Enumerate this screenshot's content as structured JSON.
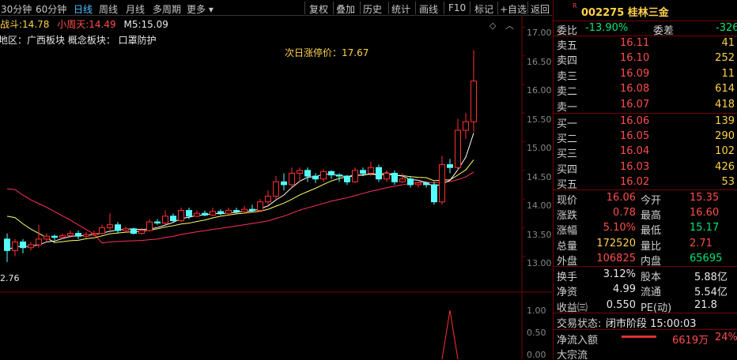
{
  "toolbar": {
    "periods": [
      "30分钟",
      "60分钟",
      "日线",
      "周线",
      "月线",
      "多周期",
      "更多"
    ],
    "more_arrow": "▾",
    "tools": [
      "复权",
      "叠加",
      "历史",
      "统计",
      "画线",
      "F10",
      "标记",
      "+自选",
      "返回"
    ]
  },
  "chart": {
    "indicator_name": "战斗:",
    "indicator_value": "14.78",
    "small_weekday_name": "小周天:",
    "small_weekday_value": "14.49",
    "ma5_label": "M5:",
    "ma5_value": "15.09",
    "region_line": "所属地区：广西板块   概念板块：   口罩防护",
    "limit_up_label": "次日涨停价：17.67",
    "low_value": "2.76",
    "yaxis_ticks": [
      "17.00",
      "16.50",
      "16.00",
      "15.50",
      "15.00",
      "14.50",
      "14.00",
      "13.50",
      "13.00"
    ],
    "vol_ticks": [
      "1.00",
      "0.50",
      "0.00"
    ],
    "colors": {
      "up": "#ff3030",
      "down": "#54ffff",
      "ma5": "#ffffff",
      "ma10": "#ffff66",
      "ma20": "#ff3060"
    }
  },
  "chart_data": {
    "type": "candlestick",
    "ylim": [
      12.76,
      17.2
    ],
    "candles": [
      {
        "o": 13.3,
        "c": 13.1,
        "h": 13.4,
        "l": 12.9
      },
      {
        "o": 13.1,
        "c": 13.25,
        "h": 13.3,
        "l": 13.0
      },
      {
        "o": 13.25,
        "c": 13.15,
        "h": 13.3,
        "l": 13.05
      },
      {
        "o": 13.15,
        "c": 13.2,
        "h": 13.25,
        "l": 13.1
      },
      {
        "o": 13.2,
        "c": 13.3,
        "h": 13.55,
        "l": 13.15
      },
      {
        "o": 13.3,
        "c": 13.35,
        "h": 13.4,
        "l": 13.25
      },
      {
        "o": 13.35,
        "c": 13.33,
        "h": 13.38,
        "l": 13.28
      },
      {
        "o": 13.33,
        "c": 13.36,
        "h": 13.4,
        "l": 13.3
      },
      {
        "o": 13.36,
        "c": 13.4,
        "h": 13.45,
        "l": 13.32
      },
      {
        "o": 13.4,
        "c": 13.35,
        "h": 13.45,
        "l": 13.3
      },
      {
        "o": 13.35,
        "c": 13.38,
        "h": 13.42,
        "l": 13.32
      },
      {
        "o": 13.38,
        "c": 13.4,
        "h": 13.45,
        "l": 13.35
      },
      {
        "o": 13.4,
        "c": 13.5,
        "h": 13.55,
        "l": 13.38
      },
      {
        "o": 13.5,
        "c": 13.55,
        "h": 13.75,
        "l": 13.45
      },
      {
        "o": 13.55,
        "c": 13.45,
        "h": 13.6,
        "l": 13.4
      },
      {
        "o": 13.45,
        "c": 13.48,
        "h": 13.52,
        "l": 13.42
      },
      {
        "o": 13.48,
        "c": 13.4,
        "h": 13.5,
        "l": 13.38
      },
      {
        "o": 13.4,
        "c": 13.45,
        "h": 13.5,
        "l": 13.38
      },
      {
        "o": 13.45,
        "c": 13.6,
        "h": 13.65,
        "l": 13.43
      },
      {
        "o": 13.6,
        "c": 13.58,
        "h": 13.65,
        "l": 13.55
      },
      {
        "o": 13.58,
        "c": 13.7,
        "h": 13.8,
        "l": 13.55
      },
      {
        "o": 13.7,
        "c": 13.62,
        "h": 13.75,
        "l": 13.6
      },
      {
        "o": 13.62,
        "c": 13.8,
        "h": 13.85,
        "l": 13.6
      },
      {
        "o": 13.8,
        "c": 13.7,
        "h": 13.85,
        "l": 13.65
      },
      {
        "o": 13.7,
        "c": 13.75,
        "h": 13.8,
        "l": 13.68
      },
      {
        "o": 13.75,
        "c": 13.72,
        "h": 13.8,
        "l": 13.7
      },
      {
        "o": 13.72,
        "c": 13.78,
        "h": 13.85,
        "l": 13.7
      },
      {
        "o": 13.78,
        "c": 13.75,
        "h": 13.82,
        "l": 13.72
      },
      {
        "o": 13.75,
        "c": 13.8,
        "h": 13.85,
        "l": 13.72
      },
      {
        "o": 13.8,
        "c": 13.78,
        "h": 13.85,
        "l": 13.75
      },
      {
        "o": 13.78,
        "c": 13.82,
        "h": 13.88,
        "l": 13.75
      },
      {
        "o": 13.82,
        "c": 13.8,
        "h": 13.9,
        "l": 13.78
      },
      {
        "o": 13.8,
        "c": 13.95,
        "h": 14.0,
        "l": 13.78
      },
      {
        "o": 13.95,
        "c": 14.05,
        "h": 14.15,
        "l": 13.9
      },
      {
        "o": 14.05,
        "c": 14.3,
        "h": 14.4,
        "l": 14.0
      },
      {
        "o": 14.3,
        "c": 14.25,
        "h": 14.45,
        "l": 14.15
      },
      {
        "o": 14.25,
        "c": 14.45,
        "h": 14.55,
        "l": 14.2
      },
      {
        "o": 14.45,
        "c": 14.5,
        "h": 14.55,
        "l": 14.3
      },
      {
        "o": 14.5,
        "c": 14.4,
        "h": 14.55,
        "l": 14.3
      },
      {
        "o": 14.4,
        "c": 14.35,
        "h": 14.45,
        "l": 14.28
      },
      {
        "o": 14.35,
        "c": 14.48,
        "h": 14.52,
        "l": 14.3
      },
      {
        "o": 14.48,
        "c": 14.42,
        "h": 14.5,
        "l": 14.35
      },
      {
        "o": 14.42,
        "c": 14.4,
        "h": 14.45,
        "l": 14.3
      },
      {
        "o": 14.4,
        "c": 14.3,
        "h": 14.42,
        "l": 14.25
      },
      {
        "o": 14.3,
        "c": 14.5,
        "h": 14.55,
        "l": 14.28
      },
      {
        "o": 14.5,
        "c": 14.45,
        "h": 14.55,
        "l": 14.4
      },
      {
        "o": 14.45,
        "c": 14.55,
        "h": 14.65,
        "l": 14.4
      },
      {
        "o": 14.55,
        "c": 14.35,
        "h": 14.6,
        "l": 14.3
      },
      {
        "o": 14.35,
        "c": 14.45,
        "h": 14.5,
        "l": 14.3
      },
      {
        "o": 14.45,
        "c": 14.3,
        "h": 14.5,
        "l": 14.25
      },
      {
        "o": 14.3,
        "c": 14.35,
        "h": 14.45,
        "l": 14.28
      },
      {
        "o": 14.35,
        "c": 14.25,
        "h": 14.4,
        "l": 14.2
      },
      {
        "o": 14.25,
        "c": 14.28,
        "h": 14.3,
        "l": 14.2
      },
      {
        "o": 14.28,
        "c": 14.25,
        "h": 14.3,
        "l": 14.2
      },
      {
        "o": 14.25,
        "c": 13.95,
        "h": 14.3,
        "l": 13.9
      },
      {
        "o": 13.95,
        "c": 14.6,
        "h": 14.75,
        "l": 13.9
      },
      {
        "o": 14.6,
        "c": 14.55,
        "h": 14.7,
        "l": 14.45
      },
      {
        "o": 14.55,
        "c": 15.2,
        "h": 15.4,
        "l": 14.5
      },
      {
        "o": 15.2,
        "c": 15.35,
        "h": 15.5,
        "l": 15.05
      },
      {
        "o": 15.35,
        "c": 16.06,
        "h": 16.6,
        "l": 15.17
      }
    ],
    "volume_spike_index": 56
  },
  "quote": {
    "r_badge": "R",
    "code_name": "002275 桂林三金",
    "weibi_label": "委比",
    "weibi_value": "-13.90%",
    "weicha_label": "委差",
    "weicha_value": "-326",
    "asks": [
      {
        "label": "卖五",
        "price": "16.11",
        "vol": "41"
      },
      {
        "label": "卖四",
        "price": "16.10",
        "vol": "252"
      },
      {
        "label": "卖三",
        "price": "16.09",
        "vol": "11"
      },
      {
        "label": "卖二",
        "price": "16.08",
        "vol": "614"
      },
      {
        "label": "卖一",
        "price": "16.07",
        "vol": "418"
      }
    ],
    "bids": [
      {
        "label": "买一",
        "price": "16.06",
        "vol": "139"
      },
      {
        "label": "买二",
        "price": "16.05",
        "vol": "290"
      },
      {
        "label": "买三",
        "price": "16.04",
        "vol": "102"
      },
      {
        "label": "买四",
        "price": "16.03",
        "vol": "426"
      },
      {
        "label": "买五",
        "price": "16.02",
        "vol": "53"
      }
    ],
    "stats": [
      {
        "l1": "现价",
        "v1": "16.06",
        "c1": "red",
        "l2": "今开",
        "v2": "15.35",
        "c2": "red"
      },
      {
        "l1": "涨跌",
        "v1": "0.78",
        "c1": "red",
        "l2": "最高",
        "v2": "16.60",
        "c2": "red"
      },
      {
        "l1": "涨幅",
        "v1": "5.10%",
        "c1": "red",
        "l2": "最低",
        "v2": "15.17",
        "c2": "green"
      },
      {
        "l1": "总量",
        "v1": "172520",
        "c1": "yellow",
        "l2": "量比",
        "v2": "2.71",
        "c2": "red"
      },
      {
        "l1": "外盘",
        "v1": "106825",
        "c1": "red",
        "l2": "内盘",
        "v2": "65695",
        "c2": "green"
      }
    ],
    "fin": [
      {
        "l1": "换手",
        "v1": "3.12%",
        "l2": "股本",
        "v2": "5.88亿"
      },
      {
        "l1": "净资",
        "v1": "4.99",
        "l2": "流通",
        "v2": "5.54亿"
      },
      {
        "l1": "收益㈢",
        "v1": "0.550",
        "l2": "PE(动)",
        "v2": "21.8"
      }
    ],
    "trade_status_label": "交易状态:",
    "trade_status_value": "闭市阶段 15:00:03",
    "net_inflow_label": "净流入额",
    "net_inflow_value": "6619万",
    "net_inflow_pct": "24%",
    "block_trade_label": "大宗流"
  }
}
